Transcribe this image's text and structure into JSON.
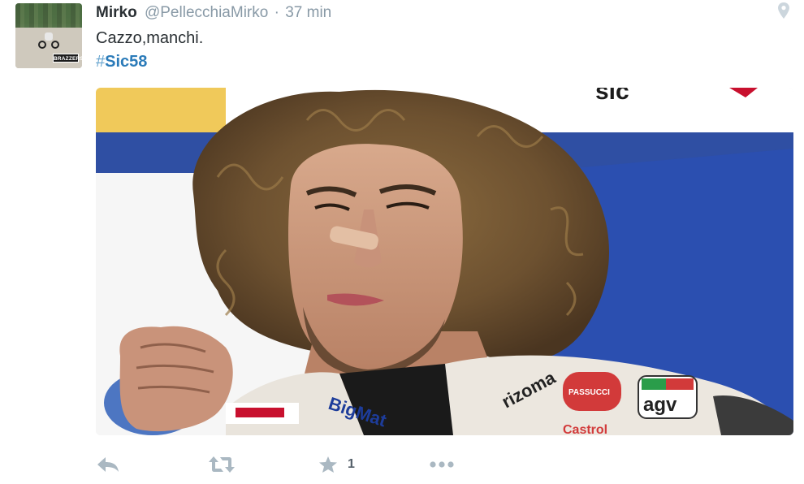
{
  "tweet": {
    "author_name": "Mirko",
    "author_handle": "@PellecchiaMirko",
    "separator": "·",
    "timestamp": "37 min",
    "text": "Cazzo,manchi.",
    "hashtag_symbol": "#",
    "hashtag_text": "Sic58",
    "avatar_logo_text": "BRAZZERS",
    "icons": {
      "location": "location-pin-icon",
      "reply": "reply-icon",
      "retweet": "retweet-icon",
      "favorite": "star-icon",
      "more": "more-dots-icon"
    },
    "favorite_count": "1",
    "media": {
      "banner_text_top": "sic",
      "suit_labels": [
        "BigMat",
        "rizoma",
        "PASSUCCI",
        "agv",
        "Castrol"
      ]
    }
  },
  "colors": {
    "hashtag_blue": "#2b7bb9",
    "meta_gray": "#8899a6",
    "icon_gray": "#aab8c2",
    "text_dark": "#292f33"
  }
}
